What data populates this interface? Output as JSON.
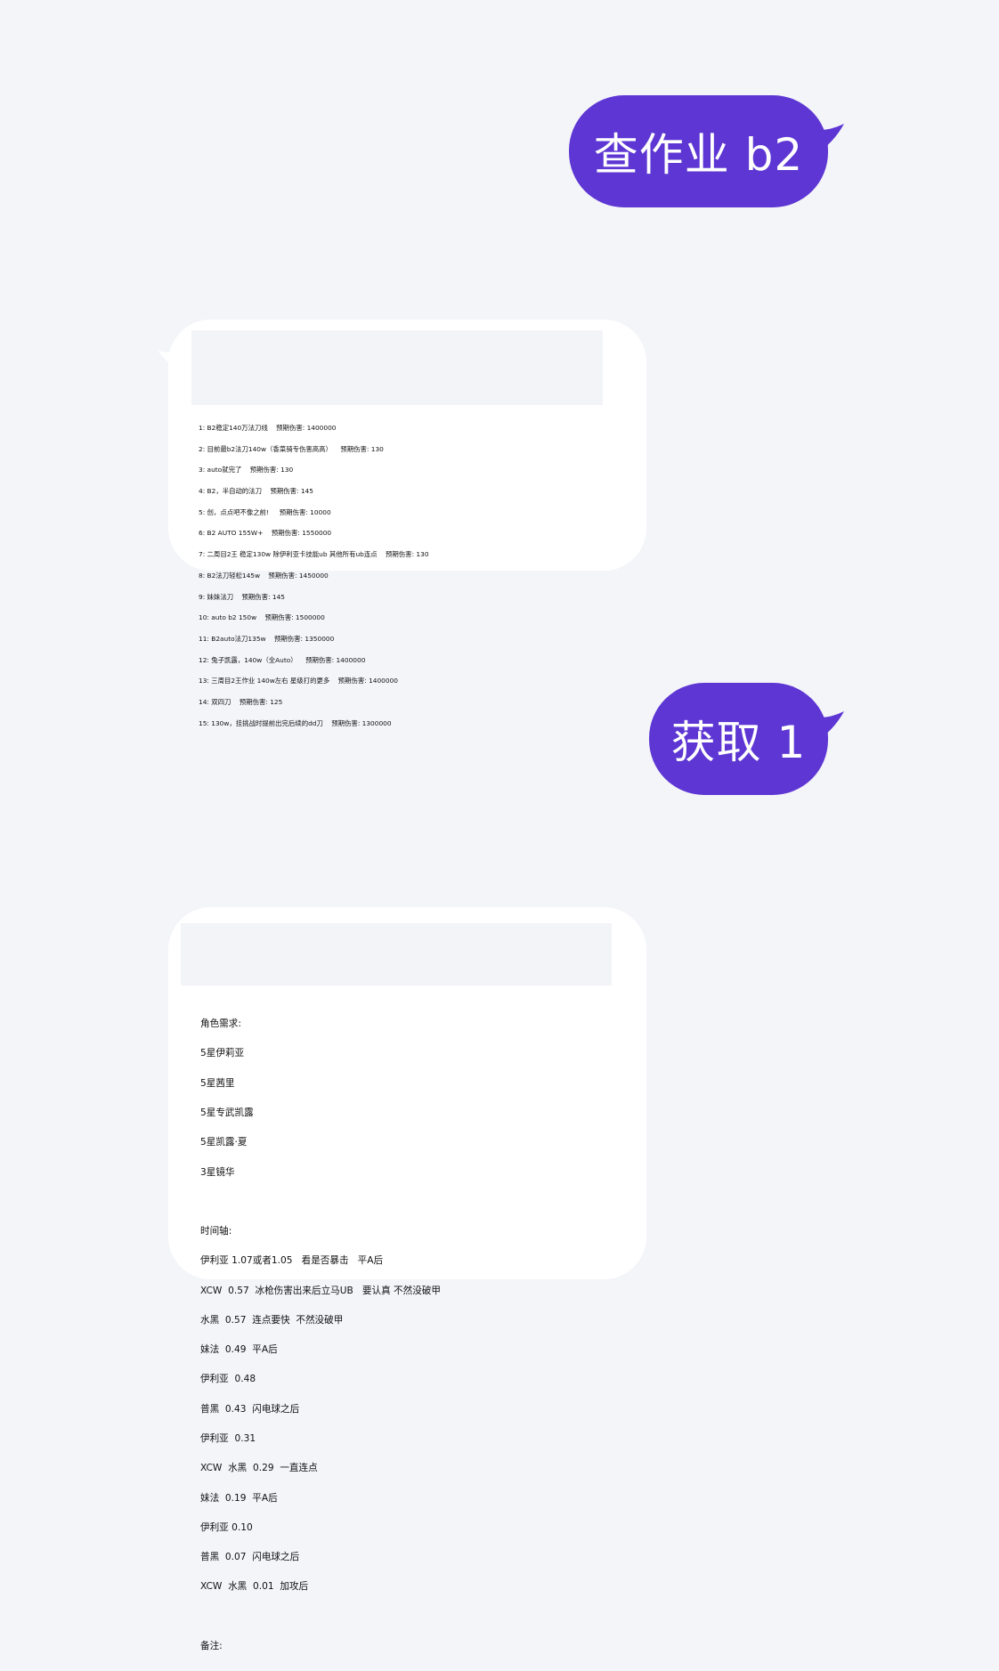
{
  "conversation": {
    "msg1": {
      "text": "查作业 b2"
    },
    "msg2": {
      "lines": [
        "1: B2稳定140万法刀线    预期伤害: 1400000",
        "2: 目前最b2法刀140w（香菜骑专伤害高高）    预期伤害: 130",
        "3: auto就完了    预期伤害: 130",
        "4: B2，半自动的法刀    预期伤害: 145",
        "5: 创，点点吧不像之前!     预期伤害: 10000",
        "6: B2 AUTO 155W+    预期伤害: 1550000",
        "7: 二周目2王 稳定130w 除伊利亚卡技能ub 其他所有ub连点    预期伤害: 130",
        "8: B2法刀轻松145w    预期伤害: 1450000",
        "9: 妹妹法刀    预期伤害: 145",
        "10: auto b2 150w    预期伤害: 1500000",
        "11: B2auto法刀135w    预期伤害: 1350000",
        "12: 兔子凯露，140w（全Auto）    预期伤害: 1400000",
        "13: 三周目2王作业 140w左右 星级打的更多    预期伤害: 1400000",
        "14: 双四刀    预期伤害: 125",
        "15: 130w，挂挑战时提前出完后续的dd刀    预期伤害: 1300000"
      ]
    },
    "msg3": {
      "text": "获取 1"
    },
    "msg4": {
      "roles_title": "角色需求:",
      "roles": [
        "5星伊莉亚",
        "5星茜里",
        "5星专武凯露",
        "5星凯露·夏",
        "3星镜华"
      ],
      "timeline_title": "时间轴:",
      "timeline": [
        "伊利亚 1.07或者1.05   看是否暴击   平A后",
        "XCW  0.57  冰枪伤害出来后立马UB   要认真 不然没破甲",
        "水黑  0.57  连点要快  不然没破甲",
        "妹法  0.49  平A后",
        "伊利亚  0.48",
        "普黑  0.43  闪电球之后",
        "伊利亚  0.31",
        "XCW  水黑  0.29  一直连点",
        "妹法  0.19  平A后",
        "伊利亚 0.10",
        "普黑  0.07  闪电球之后",
        "XCW  水黑  0.01  加攻后"
      ],
      "notes_title": "备注:"
    }
  },
  "colors": {
    "background": "#f4f5f9",
    "outgoing_bubble": "#5d36d3",
    "incoming_bubble": "#ffffff"
  }
}
